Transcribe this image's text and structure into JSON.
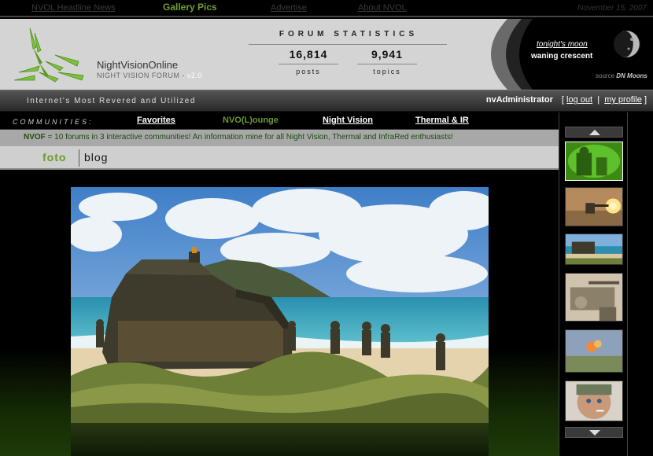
{
  "topnav": {
    "links": [
      {
        "label": "NVOL Headline News"
      },
      {
        "label": "Gallery Pics"
      },
      {
        "label": "Advertise"
      },
      {
        "label": "About NVOL"
      }
    ],
    "date": "November 15, 2007"
  },
  "brand": {
    "name": "NightVisionOnline",
    "subtitle": "NIGHT VISION FORUM",
    "version_sep": " - ",
    "version": "v2.0"
  },
  "stats": {
    "title": "FORUM STATISTICS",
    "posts_value": "16,814",
    "posts_label": "posts",
    "topics_value": "9,941",
    "topics_label": "topics"
  },
  "moon": {
    "label": "tonight's moon",
    "phase": "waning crescent",
    "source_prefix": "source",
    "source_name": "DN Moons"
  },
  "tagline": "Internet's Most Revered and Utilized",
  "user": {
    "name": "nvAdministrator",
    "open_bracket": "[",
    "logout": "log out",
    "pipe": "|",
    "profile": "my profile",
    "close_bracket": "]"
  },
  "communities": {
    "label": "COMMUNITIES:",
    "items": [
      {
        "label": "Favorites"
      },
      {
        "label": "NVO(L)ounge"
      },
      {
        "label": "Night Vision"
      },
      {
        "label": "Thermal & IR"
      }
    ]
  },
  "info": {
    "brand": "NVOF",
    "text": " = 10 forums in 3 interactive communities! An information mine for all Night Vision, Thermal and InfraRed enthusiasts!"
  },
  "section": {
    "foto": "foto",
    "blog": "blog"
  },
  "colors": {
    "accent_green": "#6a9a30",
    "header_gray": "#d4d4d4",
    "info_bar": "#a8a8a8"
  }
}
